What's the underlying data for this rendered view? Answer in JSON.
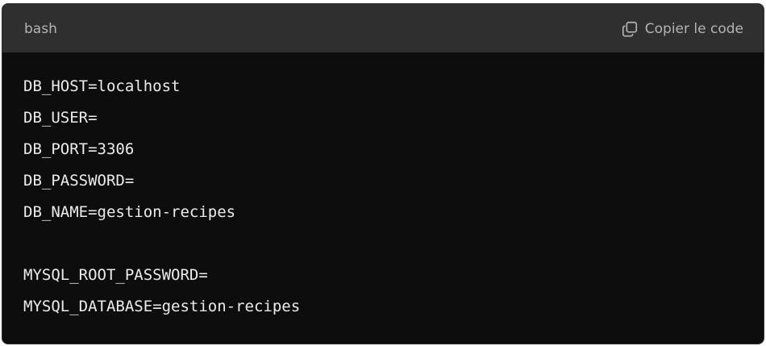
{
  "code_block": {
    "language": "bash",
    "copy_label": "Copier le code",
    "copy_icon": "copy-icon",
    "lines": [
      "DB_HOST=localhost",
      "DB_USER=",
      "DB_PORT=3306",
      "DB_PASSWORD=",
      "DB_NAME=gestion-recipes",
      "",
      "MYSQL_ROOT_PASSWORD=",
      "MYSQL_DATABASE=gestion-recipes"
    ]
  },
  "colors": {
    "header_bg": "#2f2f2f",
    "body_bg": "#0d0d0d",
    "muted_text": "#b4b4b4",
    "code_text": "#ececec"
  }
}
